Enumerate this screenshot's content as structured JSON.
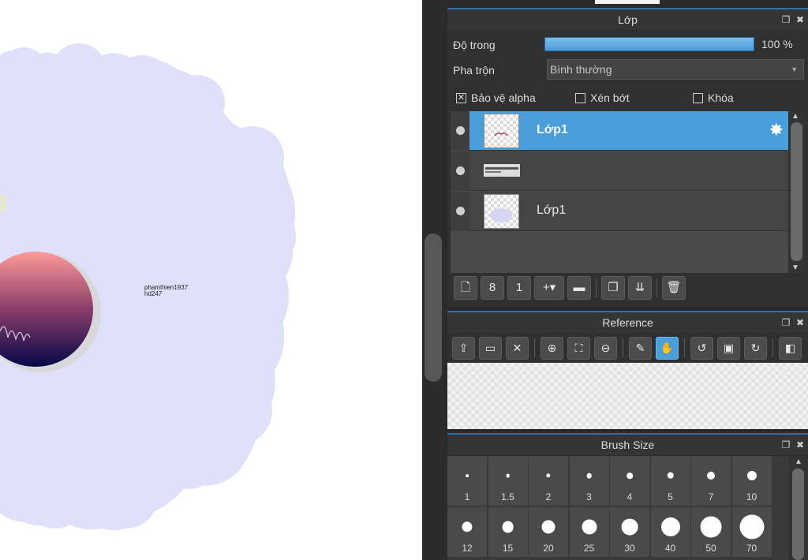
{
  "canvas": {
    "text_line1": "phamthien1937",
    "text_line2": "hd247"
  },
  "colors": {
    "accent": "#4a9fda",
    "panel_bg": "#2a2a2a",
    "canvas_cloud": "#e0e0fb",
    "gradient_top": "#ff9a9a",
    "gradient_bottom": "#050748"
  },
  "layer_panel": {
    "title": "Lớp",
    "opacity_label": "Độ trong",
    "opacity_value_text": "100 %",
    "opacity_fraction": 1.0,
    "blend_label": "Pha trộn",
    "blend_value": "Bình thường",
    "checkboxes": [
      {
        "label": "Bảo vệ alpha",
        "checked": true
      },
      {
        "label": "Xén bớt",
        "checked": false
      },
      {
        "label": "Khóa",
        "checked": false
      }
    ],
    "layers": [
      {
        "name": "Lớp1",
        "selected": true
      },
      {
        "name": "",
        "selected": false
      },
      {
        "name": "Lớp1",
        "selected": false
      }
    ],
    "tool_icons": [
      "new-layer-icon",
      "duplicate-8bit-layer-icon",
      "new-1bit-layer-icon",
      "add-layer-menu-icon",
      "folder-icon",
      "copy-layer-icon",
      "merge-down-icon",
      "delete-layer-icon"
    ]
  },
  "reference_panel": {
    "title": "Reference",
    "tool_icons": [
      "upload-icon",
      "open-folder-icon",
      "close-icon",
      "zoom-in-icon",
      "fit-icon",
      "zoom-out-icon",
      "eyedropper-icon",
      "hand-icon",
      "rotate-left-icon",
      "reset-icon",
      "rotate-right-icon",
      "flip-icon"
    ]
  },
  "brush_panel": {
    "title": "Brush Size",
    "sizes": [
      "1",
      "1.5",
      "2",
      "3",
      "4",
      "5",
      "7",
      "10",
      "12",
      "15",
      "20",
      "25",
      "30",
      "40",
      "50",
      "70"
    ]
  }
}
